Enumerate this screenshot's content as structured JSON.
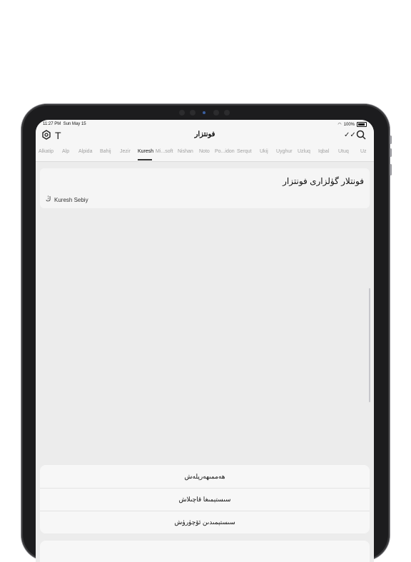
{
  "statusbar": {
    "time": "11:27 PM",
    "date": "Sun May 15",
    "battery": "100%"
  },
  "navbar": {
    "title": "فونتزار"
  },
  "icons": {
    "settings": "gear-icon",
    "font": "T",
    "check": "✓✓",
    "search": "search-icon"
  },
  "tabs": [
    {
      "label": "Alkatip"
    },
    {
      "label": "Alp"
    },
    {
      "label": "Alpida"
    },
    {
      "label": "Bahij"
    },
    {
      "label": "Jezir"
    },
    {
      "label": "Kuresh"
    },
    {
      "label": "Mi...soft"
    },
    {
      "label": "Nishan"
    },
    {
      "label": "Noto"
    },
    {
      "label": "Po...idon"
    },
    {
      "label": "Serqut"
    },
    {
      "label": "Ukij"
    },
    {
      "label": "Uyghur"
    },
    {
      "label": "Uzluq"
    },
    {
      "label": "Iqbal"
    },
    {
      "label": "Utuq"
    },
    {
      "label": "Uz"
    }
  ],
  "active_tab": "Kuresh",
  "card": {
    "title": "فونتلار گۈلزارى فونتزار",
    "font_name": "Kuresh Sebiy"
  },
  "menu": {
    "items": [
      {
        "label": "ھەممىھەرپلەش"
      },
      {
        "label": "سىستېمىغا قاچىلاش"
      },
      {
        "label": "سىستېمىدىن ئۆچۈرۈش"
      }
    ]
  }
}
